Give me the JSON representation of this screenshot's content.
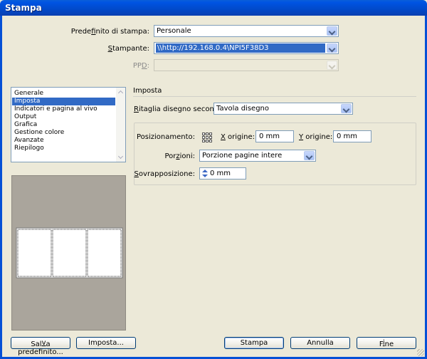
{
  "window": {
    "title": "Stampa"
  },
  "preset": {
    "label_pre": "Prede",
    "label_key": "f",
    "label_post": "inito di stampa:",
    "value": "Personale"
  },
  "printer": {
    "label_key": "S",
    "label_post": "tampante:",
    "value": "\\\\http://192.168.0.4\\NPI5F38D3"
  },
  "ppd": {
    "label_pre": "PP",
    "label_key": "D",
    "label_post": ":",
    "value": ""
  },
  "categories": {
    "items": [
      "Generale",
      "Imposta",
      "Indicatori e pagina al vivo",
      "Output",
      "Grafica",
      "Gestione colore",
      "Avanzate",
      "Riepilogo"
    ],
    "selected": "Imposta"
  },
  "setup": {
    "title": "Imposta",
    "crop": {
      "label_key": "R",
      "label_post": "itaglia disegno secondo:",
      "value": "Tavola disegno"
    },
    "positioning": {
      "label": "Posizionamento:"
    },
    "x_origin": {
      "label_key": "X",
      "label_post": " origine:",
      "value": "0 mm"
    },
    "y_origin": {
      "label_key": "Y",
      "label_post": " origine:",
      "value": "0 mm"
    },
    "tiles": {
      "label_pre": "Por",
      "label_key": "z",
      "label_post": "ioni:",
      "value": "Porzione pagine intere"
    },
    "overlap": {
      "label_key": "S",
      "label_post": "ovrapposizione:",
      "value": "0 mm"
    }
  },
  "buttons": {
    "save_preset_pre": "Sal",
    "save_preset_key": "v",
    "save_preset_post": "a predefinito...",
    "setup_pre": "Imposta...",
    "print": "Stampa",
    "cancel": "Annulla",
    "done_pre": "F",
    "done_key": "i",
    "done_post": "ne"
  }
}
